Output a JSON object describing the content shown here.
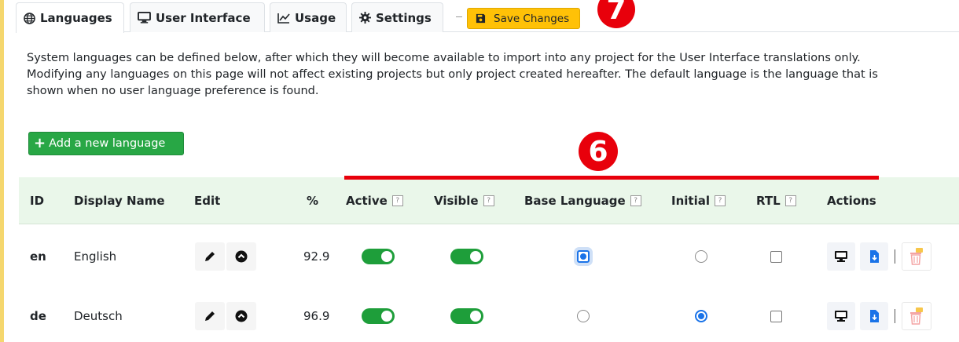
{
  "tabs": [
    {
      "label": "Languages",
      "icon": "globe-icon",
      "active": true
    },
    {
      "label": "User Interface",
      "icon": "monitor-icon",
      "active": false
    },
    {
      "label": "Usage",
      "icon": "line-chart-icon",
      "active": false
    },
    {
      "label": "Settings",
      "icon": "gear-icon",
      "active": false
    }
  ],
  "toolbar": {
    "save_label": "Save Changes"
  },
  "annotations": {
    "step7": "7",
    "step6": "6",
    "accent_color": "#e8000b"
  },
  "description": [
    "System languages can be defined below, after which they will become available to import into any project for the User Interface translations only.",
    "Modifying any languages on this page will not affect existing projects but only project created hereafter. The default language is the language that is",
    "shown when no user language preference is found."
  ],
  "add_button": {
    "label": "Add a new language"
  },
  "table": {
    "columns": {
      "id": "ID",
      "display_name": "Display Name",
      "edit": "Edit",
      "percent": "%",
      "active": "Active",
      "visible": "Visible",
      "base_language": "Base Language",
      "initial": "Initial",
      "rtl": "RTL",
      "actions": "Actions"
    },
    "help_glyph": "?",
    "rows": [
      {
        "id": "en",
        "name": "English",
        "percent": "92.9",
        "active": true,
        "visible": true,
        "base": true,
        "initial": false,
        "rtl": false
      },
      {
        "id": "de",
        "name": "Deutsch",
        "percent": "96.9",
        "active": true,
        "visible": true,
        "base": false,
        "initial": true,
        "rtl": false
      }
    ]
  },
  "colors": {
    "header_bg": "#eaf7ea",
    "toggle_on": "#1e9e3a",
    "save_bg": "#ffc107",
    "add_bg": "#28a745",
    "radio_checked": "#1a73e8"
  }
}
